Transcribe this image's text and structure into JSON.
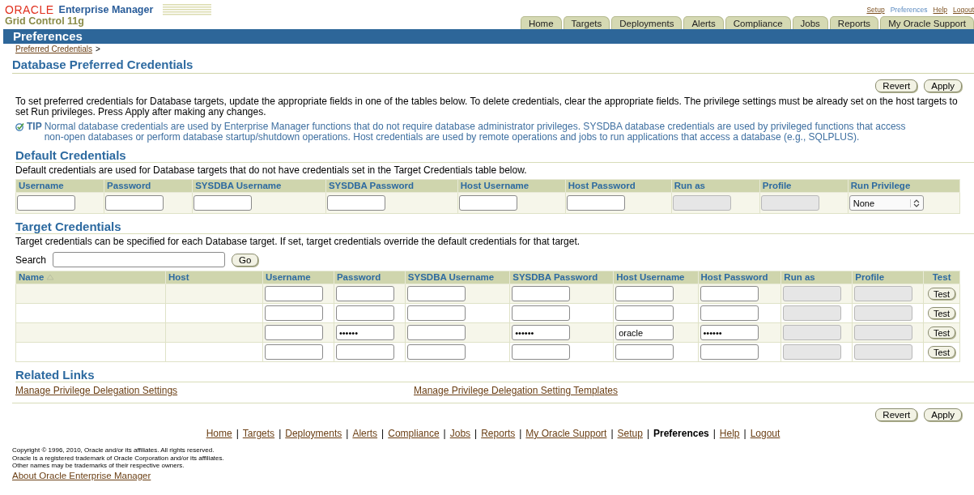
{
  "header": {
    "brand": "ORACLE",
    "product": "Enterprise Manager",
    "subtitle": "Grid Control 11g"
  },
  "global_links": [
    {
      "label": "Setup",
      "selected": false
    },
    {
      "label": "Preferences",
      "selected": true
    },
    {
      "label": "Help",
      "selected": false
    },
    {
      "label": "Logout",
      "selected": false
    }
  ],
  "tabs": [
    {
      "label": "Home",
      "selected": false
    },
    {
      "label": "Targets",
      "selected": false
    },
    {
      "label": "Deployments",
      "selected": false
    },
    {
      "label": "Alerts",
      "selected": false
    },
    {
      "label": "Compliance",
      "selected": false
    },
    {
      "label": "Jobs",
      "selected": false
    },
    {
      "label": "Reports",
      "selected": false
    },
    {
      "label": "My Oracle Support",
      "selected": false
    }
  ],
  "page_bar": {
    "title": "Preferences"
  },
  "breadcrumb": {
    "link": "Preferred Credentials",
    "separator": ">"
  },
  "page_title": "Database Preferred Credentials",
  "top_buttons": [
    "Revert",
    "Apply"
  ],
  "intro": "To set preferred credentials for Database targets, update the appropriate fields in one of the tables below. To delete credentials, clear the appropriate fields. The privilege settings must be already set on the host targets to set Run privileges. Press Apply after making any changes.",
  "tip": {
    "label": "TIP",
    "text": "Normal database credentials are used by Enterprise Manager functions that do not require database administrator privileges. SYSDBA database credentials are used by privileged functions that access non-open databases or perform database startup/shutdown operations. Host credentials are used by remote operations and jobs to run applications that access a database (e.g., SQLPLUS)."
  },
  "default_credentials": {
    "heading": "Default Credentials",
    "description": "Default credentials are used for Database targets that do not have credentials set in the Target Credentials table below.",
    "columns": [
      "Username",
      "Password",
      "SYSDBA Username",
      "SYSDBA Password",
      "Host Username",
      "Host Password",
      "Run as",
      "Profile",
      "Run Privilege"
    ],
    "fields": [
      {
        "kind": "text"
      },
      {
        "kind": "text"
      },
      {
        "kind": "text"
      },
      {
        "kind": "text"
      },
      {
        "kind": "text"
      },
      {
        "kind": "text"
      },
      {
        "kind": "disabled"
      },
      {
        "kind": "disabled"
      },
      {
        "kind": "select",
        "value": "None"
      }
    ]
  },
  "target_credentials": {
    "heading": "Target Credentials",
    "description": "Target credentials can be specified for each Database target. If set, target credentials override the default credentials for that target.",
    "search": {
      "label": "Search",
      "button": "Go"
    },
    "columns": [
      {
        "label": "Name",
        "sorted": true
      },
      {
        "label": "Host",
        "sorted": false
      },
      {
        "label": "Username",
        "sorted": false
      },
      {
        "label": "Password",
        "sorted": false
      },
      {
        "label": "SYSDBA Username",
        "sorted": false
      },
      {
        "label": "SYSDBA Password",
        "sorted": false
      },
      {
        "label": "Host Username",
        "sorted": false
      },
      {
        "label": "Host Password",
        "sorted": false
      },
      {
        "label": "Run as",
        "sorted": false
      },
      {
        "label": "Profile",
        "sorted": false
      },
      {
        "label": "Test",
        "sorted": false
      }
    ],
    "rows": [
      {
        "fields": [
          {
            "kind": "text"
          },
          {
            "kind": "text"
          },
          {
            "kind": "text"
          },
          {
            "kind": "text"
          },
          {
            "kind": "text"
          },
          {
            "kind": "text"
          },
          {
            "kind": "disabled"
          },
          {
            "kind": "disabled"
          }
        ],
        "test": "Test"
      },
      {
        "fields": [
          {
            "kind": "text"
          },
          {
            "kind": "text"
          },
          {
            "kind": "text"
          },
          {
            "kind": "text"
          },
          {
            "kind": "text"
          },
          {
            "kind": "text"
          },
          {
            "kind": "disabled"
          },
          {
            "kind": "disabled"
          }
        ],
        "test": "Test"
      },
      {
        "fields": [
          {
            "kind": "text"
          },
          {
            "kind": "text",
            "value": "••••••"
          },
          {
            "kind": "text"
          },
          {
            "kind": "text",
            "value": "••••••"
          },
          {
            "kind": "text",
            "value": "oracle"
          },
          {
            "kind": "text",
            "value": "••••••"
          },
          {
            "kind": "disabled"
          },
          {
            "kind": "disabled"
          }
        ],
        "test": "Test"
      },
      {
        "fields": [
          {
            "kind": "text"
          },
          {
            "kind": "text"
          },
          {
            "kind": "text"
          },
          {
            "kind": "text"
          },
          {
            "kind": "text"
          },
          {
            "kind": "text"
          },
          {
            "kind": "disabled"
          },
          {
            "kind": "disabled"
          }
        ],
        "test": "Test"
      }
    ]
  },
  "related_links": {
    "heading": "Related Links",
    "links": [
      "Manage Privilege Delegation Settings",
      "Manage Privilege Delegation Setting Templates"
    ]
  },
  "bottom_buttons": [
    "Revert",
    "Apply"
  ],
  "footer_separator": "|",
  "footer_nav": [
    {
      "label": "Home",
      "selected": false
    },
    {
      "label": "Targets",
      "selected": false
    },
    {
      "label": "Deployments",
      "selected": false
    },
    {
      "label": "Alerts",
      "selected": false
    },
    {
      "label": "Compliance",
      "selected": false
    },
    {
      "label": "Jobs",
      "selected": false
    },
    {
      "label": "Reports",
      "selected": false
    },
    {
      "label": "My Oracle Support",
      "selected": false
    },
    {
      "label": "Setup",
      "selected": false
    },
    {
      "label": "Preferences",
      "selected": true
    },
    {
      "label": "Help",
      "selected": false
    },
    {
      "label": "Logout",
      "selected": false
    }
  ],
  "copyright": [
    "Copyright © 1996, 2010, Oracle and/or its affiliates. All rights reserved.",
    "Oracle is a registered trademark of Oracle Corporation and/or its affiliates.",
    "Other names may be trademarks of their respective owners."
  ],
  "about_link": "About Oracle Enterprise Manager"
}
